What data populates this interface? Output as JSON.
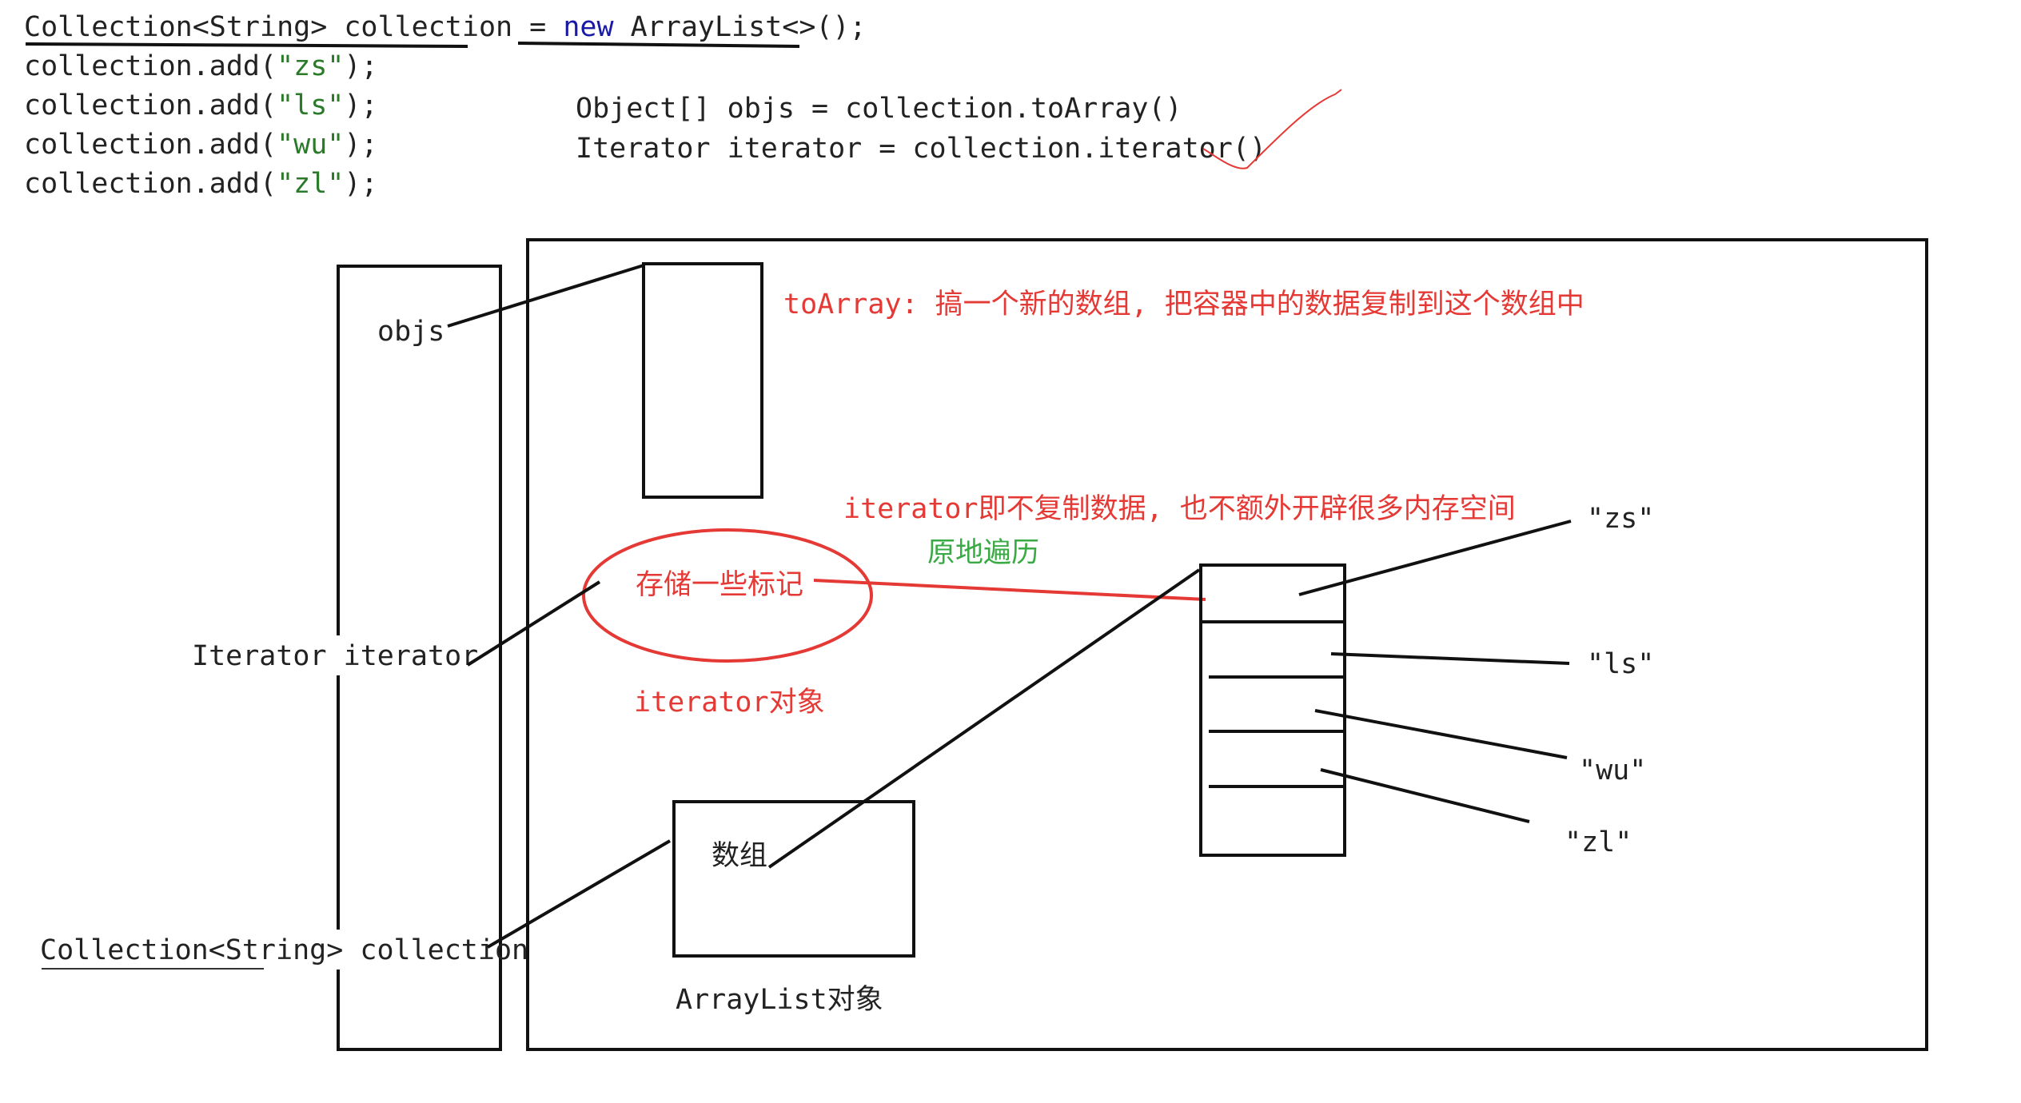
{
  "colors": {
    "ink": "#111111",
    "accent_red": "#e53935",
    "accent_green": "#3aaa44",
    "keyword_blue": "#1a1aa6"
  },
  "code": {
    "line1_type": "Collection<String> collection",
    "line1_eq": " = ",
    "line1_new": "new",
    "line1_rest": " ArrayList<>();",
    "add_lines": [
      {
        "pre": "collection.add(",
        "arg": "\"zs\"",
        "post": ");"
      },
      {
        "pre": "collection.add(",
        "arg": "\"ls\"",
        "post": ");"
      },
      {
        "pre": "collection.add(",
        "arg": "\"wu\"",
        "post": ");"
      },
      {
        "pre": "collection.add(",
        "arg": "\"zl\"",
        "post": ");"
      }
    ],
    "toarray_line": "Object[] objs = collection.toArray()",
    "iterator_line": "Iterator iterator = collection.iterator()"
  },
  "stack": {
    "objs": "objs",
    "iterator": "Iterator iterator",
    "collection_type": "Collection<String>",
    "collection_name": " collection"
  },
  "heap": {
    "toarray_note": "toArray: 搞一个新的数组, 把容器中的数据复制到这个数组中",
    "iterator_note": "iterator即不复制数据, 也不额外开辟很多内存空间",
    "in_place": "原地遍历",
    "marker": "存储一些标记",
    "iterator_object": "iterator对象",
    "array_label": "数组",
    "arraylist_object": "ArrayList对象",
    "values": [
      "\"zs\"",
      "\"ls\"",
      "\"wu\"",
      "\"zl\""
    ]
  }
}
